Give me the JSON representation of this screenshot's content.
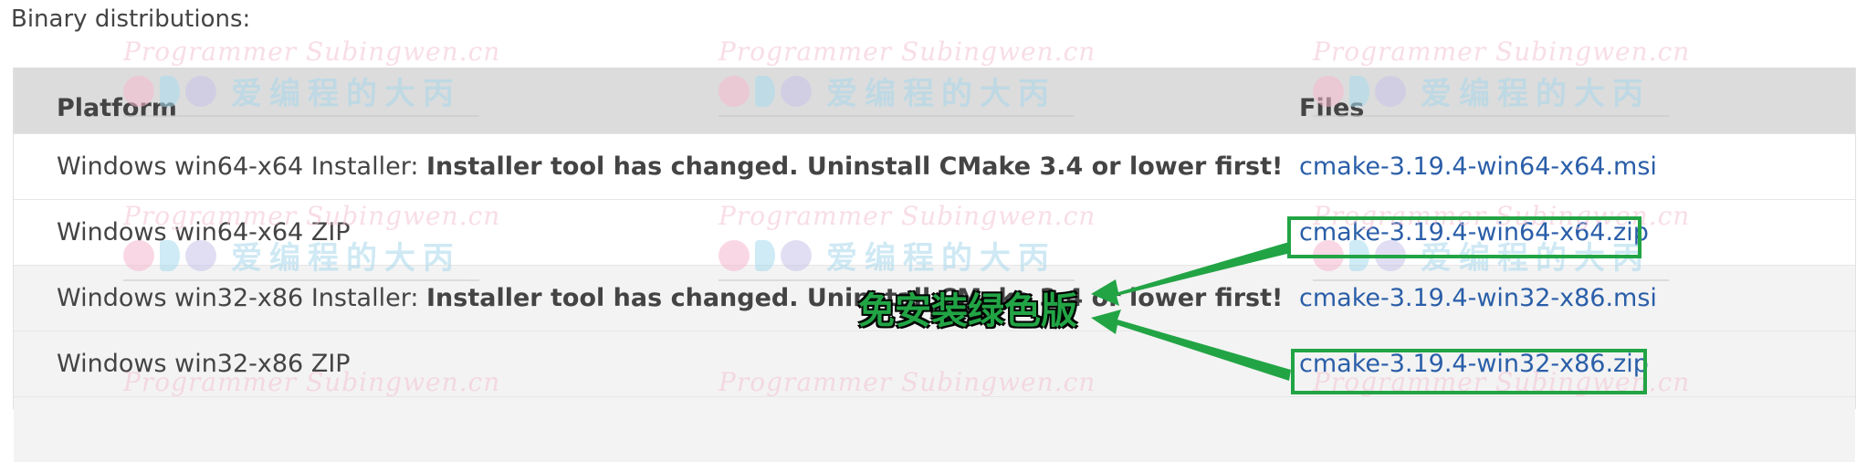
{
  "section": {
    "heading": "Binary distributions:"
  },
  "table": {
    "headers": {
      "platform": "Platform",
      "files": "Files"
    },
    "rows": [
      {
        "platform_prefix": "Windows win64-x64 Installer: ",
        "platform_note": "Installer tool has changed. Uninstall CMake 3.4 or lower first!",
        "file": "cmake-3.19.4-win64-x64.msi"
      },
      {
        "platform_prefix": "Windows win64-x64 ZIP",
        "platform_note": "",
        "file": "cmake-3.19.4-win64-x64.zip"
      },
      {
        "platform_prefix": "Windows win32-x86 Installer: ",
        "platform_note": "Installer tool has changed. Uninstall CMake 3.4 or lower first!",
        "file": "cmake-3.19.4-win32-x86.msi"
      },
      {
        "platform_prefix": "Windows win32-x86 ZIP",
        "platform_note": "",
        "file": "cmake-3.19.4-win32-x86.zip"
      }
    ]
  },
  "annotation": {
    "label": "免安装绿色版",
    "color": "#22a445"
  },
  "watermark": {
    "site": "Programmer Subingwen.cn",
    "name": "爱编程的大丙"
  },
  "colors": {
    "link": "#2a5ea8",
    "header_bg": "#dcdcdc",
    "shaded_row": "#f3f3f3"
  }
}
